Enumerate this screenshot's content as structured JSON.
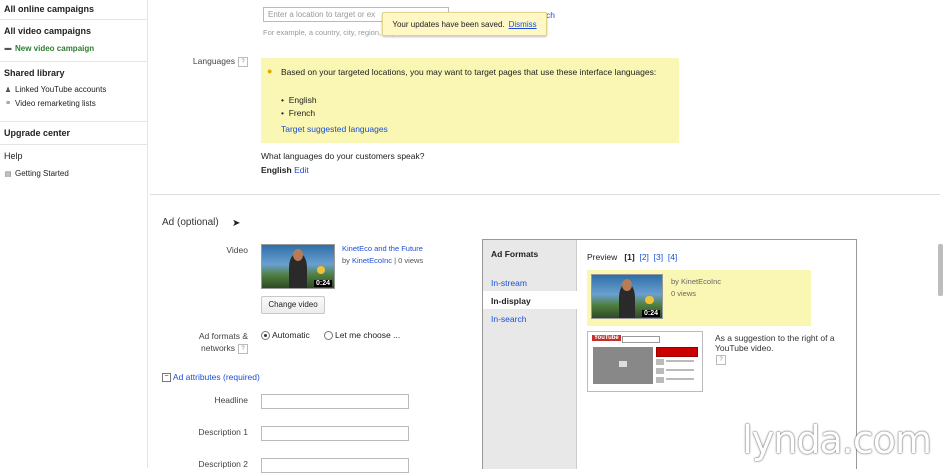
{
  "sidebar": {
    "all_online": "All online campaigns",
    "all_video": "All video campaigns",
    "new_video": "New video campaign",
    "shared_library": "Shared library",
    "linked_accounts": "Linked YouTube accounts",
    "remarketing": "Video remarketing lists",
    "upgrade": "Upgrade center",
    "help": "Help",
    "getting_started": "Getting Started"
  },
  "location": {
    "placeholder": "Enter a location to target or ex",
    "search_fragment": "ch",
    "hint": "For example, a country, city, region, or postal code"
  },
  "toast": {
    "message": "Your updates have been saved.",
    "dismiss": "Dismiss"
  },
  "languages": {
    "label": "Languages",
    "suggestion": "Based on your targeted locations, you may want to target pages that use these interface languages:",
    "items": [
      "English",
      "French"
    ],
    "target_link": "Target suggested languages",
    "question": "What languages do your customers speak?",
    "current": "English",
    "edit": "Edit"
  },
  "ad": {
    "section_title": "Ad (optional)",
    "video_label": "Video",
    "video_title": "KinetEco and the Future",
    "by": "by",
    "channel": "KinetEcoInc",
    "views": "| 0 views",
    "duration": "0:24",
    "change_video": "Change video",
    "formats_label": "Ad formats &",
    "networks_label": "networks",
    "automatic": "Automatic",
    "let_me": "Let me choose ...",
    "attributes": "Ad attributes (required)",
    "headline": "Headline",
    "desc1": "Description 1",
    "desc2": "Description 2"
  },
  "panel": {
    "title": "Ad Formats",
    "formats": [
      "In-stream",
      "In-display",
      "In-search"
    ],
    "preview": "Preview",
    "pages": [
      "[1]",
      "[2]",
      "[3]",
      "[4]"
    ],
    "by_channel": "by KinetEcoInc",
    "views": "0 views",
    "suggestion": "As a suggestion to the right of a YouTube video.",
    "youtube": "YouTube"
  },
  "watermark": "lynda.com"
}
